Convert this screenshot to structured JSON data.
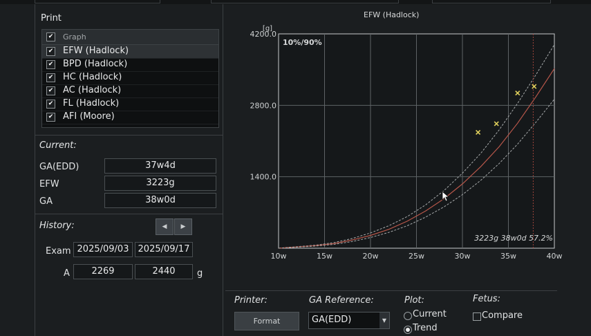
{
  "print": {
    "title": "Print",
    "header_label": "Graph",
    "items": [
      {
        "label": "EFW (Hadlock)",
        "checked": true,
        "selected": true
      },
      {
        "label": "BPD (Hadlock)",
        "checked": true,
        "selected": false
      },
      {
        "label": "HC (Hadlock)",
        "checked": true,
        "selected": false
      },
      {
        "label": "AC (Hadlock)",
        "checked": true,
        "selected": false
      },
      {
        "label": "FL (Hadlock)",
        "checked": true,
        "selected": false
      },
      {
        "label": "AFI (Moore)",
        "checked": true,
        "selected": false
      }
    ]
  },
  "current": {
    "title": "Current:",
    "rows": [
      {
        "label": "GA(EDD)",
        "value": "37w4d"
      },
      {
        "label": "EFW",
        "value": "3223g"
      },
      {
        "label": "GA",
        "value": "38w0d"
      }
    ]
  },
  "history": {
    "title": "History:",
    "exam_label": "Exam",
    "exams": [
      "2025/09/03",
      "2025/09/17"
    ],
    "a_label": "A",
    "values": [
      "2269",
      "2440"
    ],
    "unit": "g"
  },
  "chart_data": {
    "type": "line",
    "title": "EFW (Hadlock)",
    "ylabel": "[g]",
    "percentile_label": "10%/90%",
    "annotation": "3223g 38w0d 57.2%",
    "xlim": [
      10,
      40
    ],
    "ylim": [
      0,
      4200
    ],
    "x_ticks": [
      10,
      15,
      20,
      25,
      30,
      35,
      40
    ],
    "x_tick_labels": [
      "10w",
      "15w",
      "20w",
      "25w",
      "30w",
      "35w",
      "40w"
    ],
    "y_ticks": [
      1400,
      2800,
      4200
    ],
    "y_tick_labels": [
      "1400.0",
      "2800.0",
      "4200.0"
    ],
    "grid": true,
    "current_ga_marker": 37.7,
    "series": [
      {
        "x": [
          10,
          12,
          14,
          16,
          18,
          20,
          22,
          24,
          26,
          28,
          30,
          32,
          34,
          36,
          38,
          40
        ],
        "values": [
          0,
          30,
          60,
          110,
          190,
          300,
          440,
          620,
          850,
          1130,
          1470,
          1860,
          2320,
          2840,
          3400,
          3990
        ],
        "style": "dashed"
      },
      {
        "x": [
          10,
          12,
          14,
          16,
          18,
          20,
          22,
          24,
          26,
          28,
          30,
          32,
          34,
          36,
          38,
          40
        ],
        "values": [
          0,
          25,
          50,
          90,
          160,
          250,
          370,
          530,
          730,
          970,
          1260,
          1600,
          1990,
          2450,
          2970,
          3520
        ],
        "style": "solid"
      },
      {
        "x": [
          10,
          12,
          14,
          16,
          18,
          20,
          22,
          24,
          26,
          28,
          30,
          32,
          34,
          36,
          38,
          40
        ],
        "values": [
          0,
          20,
          40,
          75,
          130,
          210,
          310,
          440,
          610,
          810,
          1050,
          1330,
          1660,
          2040,
          2470,
          2920
        ],
        "style": "dashed"
      }
    ],
    "points": [
      {
        "x": 31.7,
        "y": 2270
      },
      {
        "x": 33.7,
        "y": 2440
      },
      {
        "x": 36.0,
        "y": 3040
      },
      {
        "x": 37.8,
        "y": 3170
      }
    ],
    "colors": {
      "median": "#b8574a",
      "percentile": "#a7aaab",
      "points": "#e0d05c",
      "marker": "#a0443c"
    }
  },
  "bottom": {
    "printer_label": "Printer:",
    "format_label": "Format",
    "ga_ref_label": "GA Reference:",
    "ga_ref_value": "GA(EDD)",
    "plot_label": "Plot:",
    "plot_options": [
      {
        "label": "Current",
        "selected": false
      },
      {
        "label": "Trend",
        "selected": true
      }
    ],
    "fetus_label": "Fetus:",
    "compare_label": "Compare"
  },
  "icons": {
    "nav_prev": "chevron-left-icon",
    "nav_next": "chevron-right-icon",
    "dropdown": "chevron-down-icon"
  }
}
